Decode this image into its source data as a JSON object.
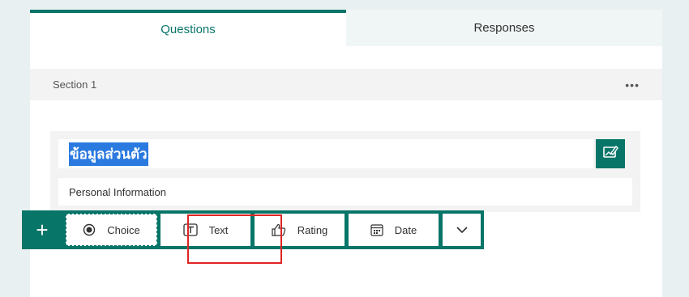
{
  "tabs": {
    "questions": "Questions",
    "responses": "Responses"
  },
  "section": {
    "label": "Section 1",
    "more": "•••"
  },
  "title_box": {
    "title": "ข้อมูลส่วนตัว",
    "description": "Personal Information"
  },
  "toolbar": {
    "add": "+",
    "choice": "Choice",
    "text": "Text",
    "rating": "Rating",
    "date": "Date"
  },
  "colors": {
    "accent": "#077568",
    "highlight": "#e02424",
    "selection": "#2b7ae0"
  },
  "icons": [
    "plus-icon",
    "radio-icon",
    "text-icon",
    "thumbs-up-icon",
    "calendar-icon",
    "chevron-down-icon",
    "image-edit-icon",
    "more-icon"
  ]
}
